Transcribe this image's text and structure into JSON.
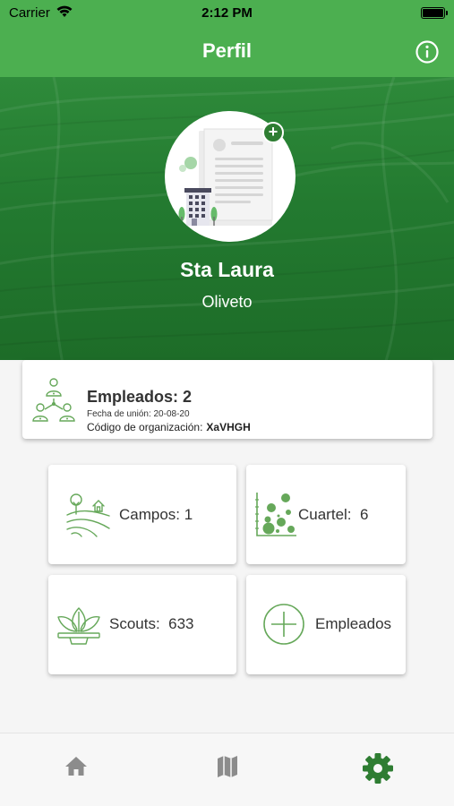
{
  "status_bar": {
    "carrier": "Carrier",
    "time": "2:12 PM"
  },
  "nav": {
    "title": "Perfil",
    "info_icon": "info-icon"
  },
  "profile": {
    "name": "Sta Laura",
    "subtitle": "Oliveto",
    "add_icon": "plus-icon"
  },
  "info_card": {
    "employees": "Empleados: 2",
    "join_date": "Fecha de unión: 20-08-20",
    "org_code_label": "Código de organización:",
    "org_code_value": "XaVHGH"
  },
  "tiles": [
    {
      "label": "Campos: 1",
      "icon": "fields-icon"
    },
    {
      "label": "Cuartel:  6",
      "icon": "scatter-icon"
    },
    {
      "label": "Scouts:  633",
      "icon": "plant-icon"
    },
    {
      "label": "Empleados",
      "icon": "add-circle-icon"
    }
  ],
  "tabbar": {
    "items": [
      {
        "icon": "home-icon",
        "active": false
      },
      {
        "icon": "map-icon",
        "active": false
      },
      {
        "icon": "settings-icon",
        "active": true
      }
    ]
  },
  "colors": {
    "primary": "#4caf50",
    "primary_dark": "#2e7d32",
    "icon_green": "#66a85a",
    "tab_inactive": "#8c8c8c"
  }
}
